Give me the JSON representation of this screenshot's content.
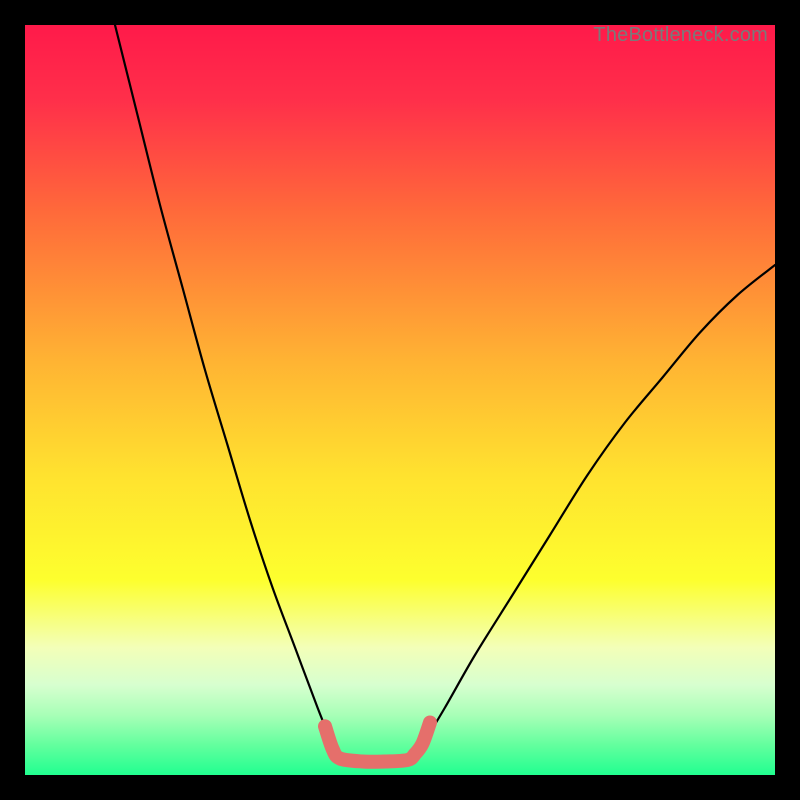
{
  "watermark": "TheBottleneck.com",
  "chart_data": {
    "type": "line",
    "title": "",
    "xlabel": "",
    "ylabel": "",
    "xlim": [
      0,
      100
    ],
    "ylim": [
      0,
      100
    ],
    "series": [
      {
        "name": "curve-left",
        "x": [
          12,
          15,
          18,
          21,
          24,
          27,
          30,
          33,
          36,
          39,
          41
        ],
        "y": [
          100,
          88,
          76,
          65,
          54,
          44,
          34,
          25,
          17,
          9,
          4
        ]
      },
      {
        "name": "curve-right",
        "x": [
          53,
          56,
          60,
          65,
          70,
          75,
          80,
          85,
          90,
          95,
          100
        ],
        "y": [
          4,
          9,
          16,
          24,
          32,
          40,
          47,
          53,
          59,
          64,
          68
        ]
      },
      {
        "name": "highlight-segment",
        "x": [
          40,
          41,
          42,
          45,
          48,
          51,
          52,
          53,
          54
        ],
        "y": [
          6.5,
          3.5,
          2.2,
          1.8,
          1.8,
          2.0,
          2.8,
          4.2,
          7.0
        ]
      }
    ],
    "gradient_stops": [
      {
        "offset": 0.0,
        "color": "#ff1a4a"
      },
      {
        "offset": 0.1,
        "color": "#ff2f4a"
      },
      {
        "offset": 0.25,
        "color": "#ff6a3a"
      },
      {
        "offset": 0.45,
        "color": "#ffb433"
      },
      {
        "offset": 0.6,
        "color": "#ffe22f"
      },
      {
        "offset": 0.74,
        "color": "#fdff2e"
      },
      {
        "offset": 0.83,
        "color": "#f3ffb8"
      },
      {
        "offset": 0.88,
        "color": "#d7ffcf"
      },
      {
        "offset": 0.92,
        "color": "#a8ffb7"
      },
      {
        "offset": 0.96,
        "color": "#63ff9e"
      },
      {
        "offset": 1.0,
        "color": "#21ff90"
      }
    ],
    "colors": {
      "curve": "#000000",
      "highlight": "#e56f6b",
      "background_frame": "#000000"
    }
  }
}
